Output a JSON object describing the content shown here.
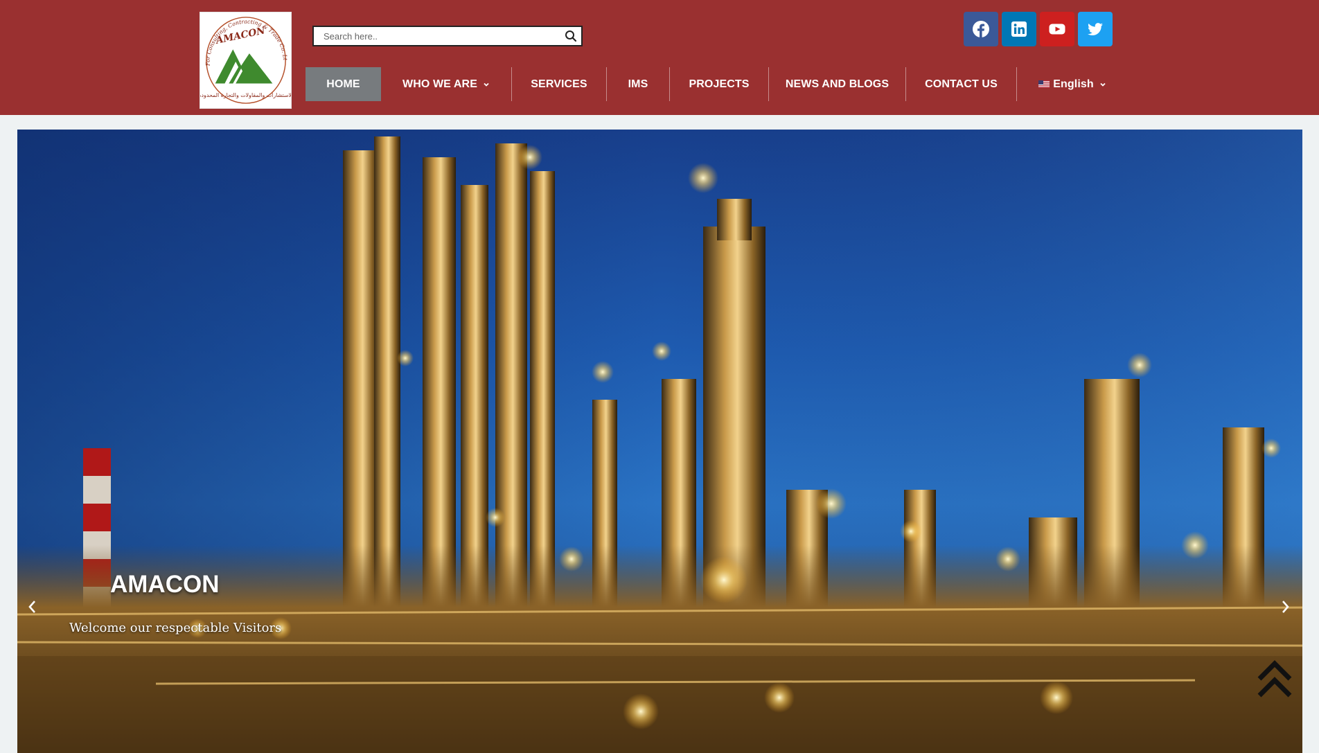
{
  "header": {
    "background": "#9a3030",
    "logo": {
      "alt": "AMACON logo",
      "brand": "AMACON",
      "arc_text": "For Consulting, Contracting & Trade Co. Ltd",
      "arabic_text": "للاستشارات والمقاولات والتجارة المحدودة"
    },
    "search": {
      "placeholder": "Search here..",
      "value": "",
      "icon": "search-icon"
    },
    "social": [
      {
        "name": "facebook",
        "icon": "facebook-icon",
        "color": "#3b5998"
      },
      {
        "name": "linkedin",
        "icon": "linkedin-icon",
        "color": "#0077b5"
      },
      {
        "name": "youtube",
        "icon": "youtube-icon",
        "color": "#cd201f"
      },
      {
        "name": "twitter",
        "icon": "twitter-icon",
        "color": "#1da1f2"
      }
    ]
  },
  "nav": {
    "items": [
      {
        "label": "HOME",
        "active": true
      },
      {
        "label": "WHO WE ARE",
        "dropdown": true
      },
      {
        "label": "SERVICES"
      },
      {
        "label": "IMS"
      },
      {
        "label": "PROJECTS"
      },
      {
        "label": "NEWS AND BLOGS"
      },
      {
        "label": "CONTACT US"
      },
      {
        "label": "English",
        "dropdown": true,
        "icon": "us-flag-icon"
      }
    ],
    "active_color": "#777b7e"
  },
  "hero": {
    "title": "AMACON",
    "subtitle": "Welcome our respectable Visitors",
    "prev_icon": "chevron-left-icon",
    "next_icon": "chevron-right-icon"
  },
  "scroll_top": {
    "icon": "double-chevron-up-icon"
  }
}
